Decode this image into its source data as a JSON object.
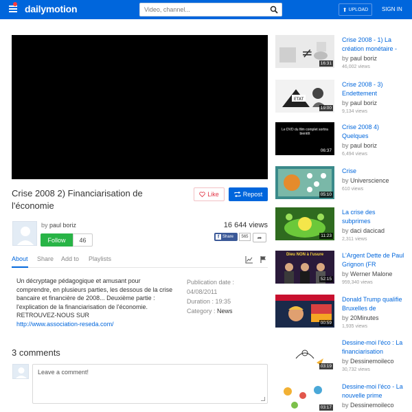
{
  "header": {
    "logo": "dailymotion",
    "search_placeholder": "Video, channel...",
    "upload_label": "UPLOAD",
    "signin_label": "SIGN IN"
  },
  "video": {
    "title": "Crise 2008 2) Financiarisation de l'économie",
    "like_label": "Like",
    "repost_label": "Repost",
    "by_prefix": "by",
    "channel": "paul boriz",
    "follow_label": "Follow",
    "follower_count": "46",
    "views": "16 644 views",
    "fb_share_label": "Share",
    "fb_share_count": "565"
  },
  "tabs": [
    {
      "label": "About",
      "active": true
    },
    {
      "label": "Share"
    },
    {
      "label": "Add to"
    },
    {
      "label": "Playlists"
    }
  ],
  "description": {
    "text": "Un décryptage pédagogique et amusant pour comprendre, en plusieurs parties, les dessous de la crise bancaire et financière de 2008... Deuxième partie : l'explication de la financiarisation de l'économie.",
    "retrouvez": "RETROUVEZ-NOUS SUR",
    "link": "http://www.association-reseda.com/"
  },
  "meta": {
    "publication_label": "Publication date :",
    "publication_date": "04/08/2011",
    "duration_label": "Duration :",
    "duration": "19:35",
    "category_label": "Category :",
    "category": "News"
  },
  "comments": {
    "title": "3 comments",
    "placeholder": "Leave a comment!"
  },
  "sidebar": {
    "items": [
      {
        "title": "Crise 2008 - 1) La création monétaire -",
        "by": "paul boriz",
        "views": "46,002 views",
        "duration": "16:31"
      },
      {
        "title": "Crise 2008 - 3) Endettement",
        "by": "paul boriz",
        "views": "9,134 views",
        "duration": "19:00"
      },
      {
        "title": "Crise 2008 4) Quelques",
        "by": "paul boriz",
        "views": "6,494 views",
        "duration": "06:37",
        "thumb_text": "Le DVD du film complet sortira bientôt"
      },
      {
        "title": "Crise",
        "by": "Universcience",
        "views": "610 views",
        "duration": "05:10"
      },
      {
        "title": "La crise des subprimes",
        "by": "daci dacicad",
        "views": "2,311 views",
        "duration": "11:23"
      },
      {
        "title": "L'Argent Dette de Paul Grignon (FR",
        "by": "Werner Malone",
        "views": "959,340 views",
        "duration": "52:15",
        "thumb_text": "Dieu NON à l'usure"
      },
      {
        "title": "Donald Trump qualifie Bruxelles de",
        "by": "20Minutes",
        "views": "1,935 views",
        "duration": "00:59"
      },
      {
        "title": "Dessine-moi l'éco : La financiarisation",
        "by": "Dessinemoileco",
        "views": "30,732 views",
        "duration": "03:19"
      },
      {
        "title": "Dessine-moi l'éco - La nouvelle prime",
        "by": "Dessinemoileco",
        "views": "",
        "duration": "03:17"
      }
    ]
  },
  "colors": {
    "brand_blue": "#0066dc",
    "follow_green": "#28b446",
    "like_red": "#e23748"
  }
}
